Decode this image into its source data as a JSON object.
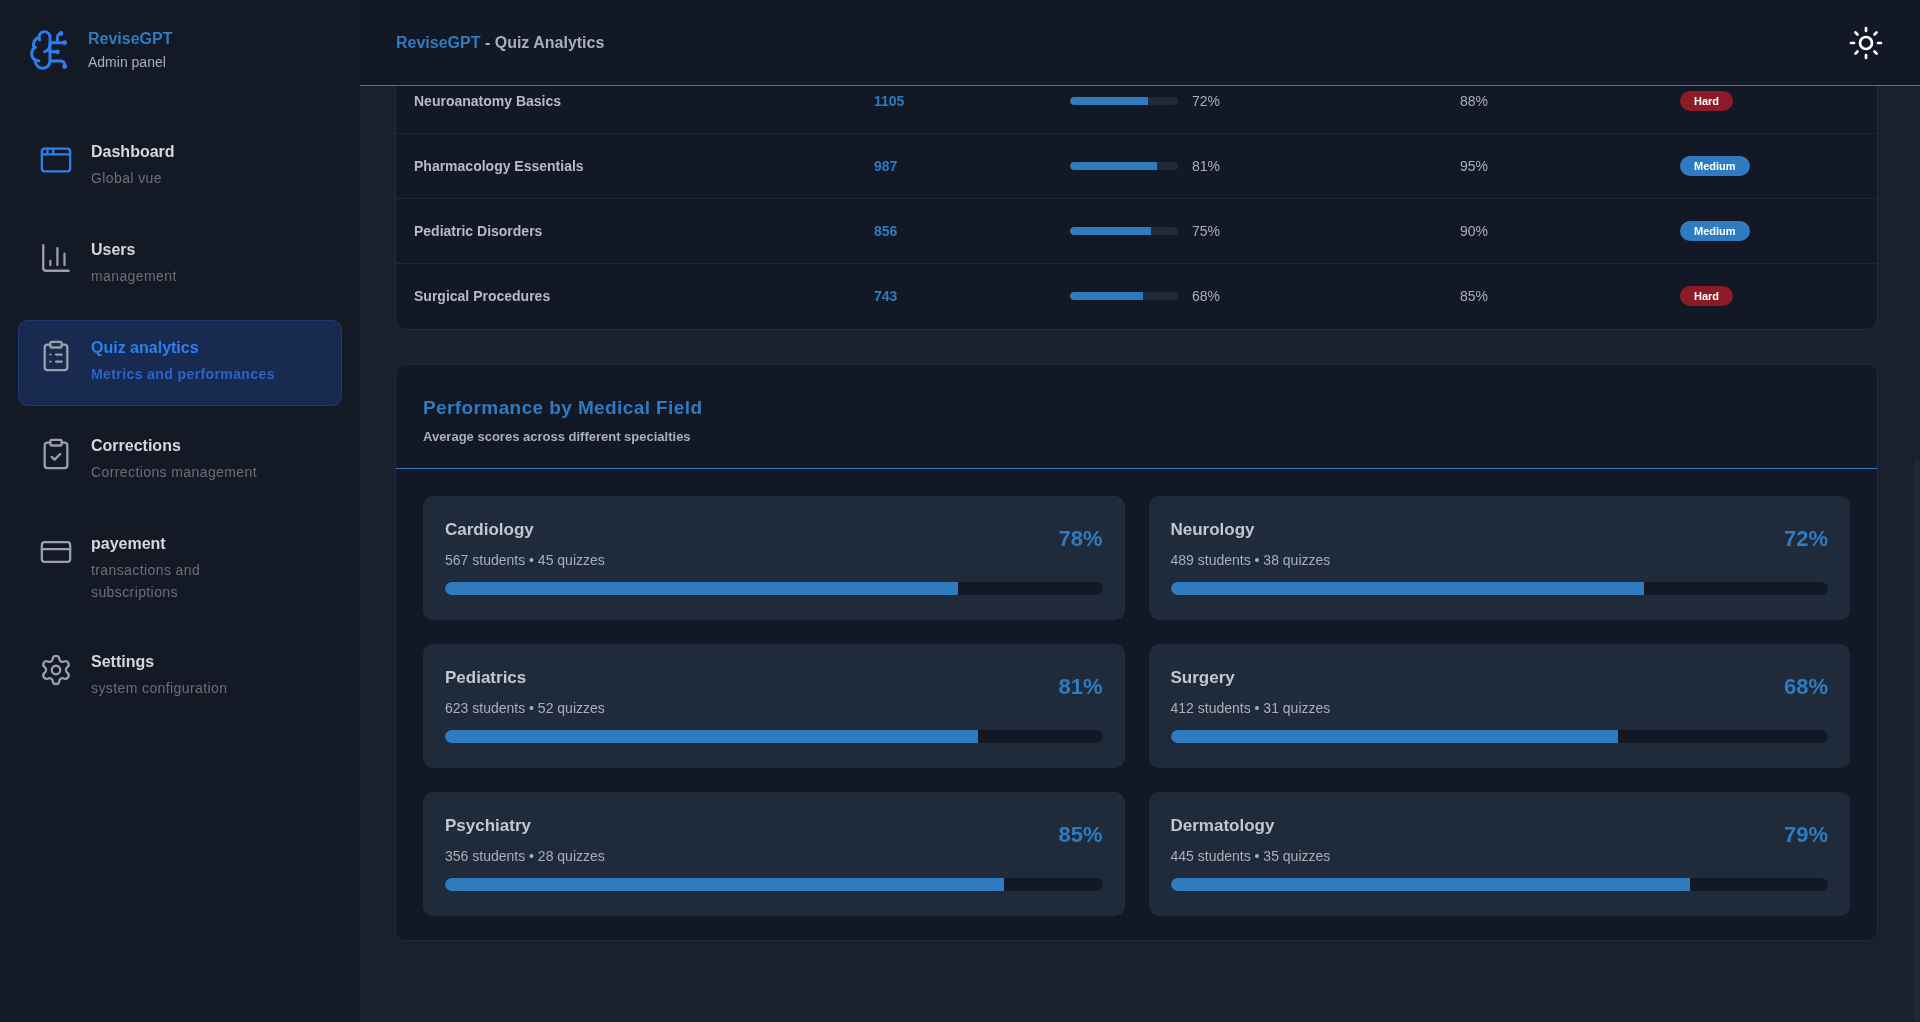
{
  "brand": {
    "name": "ReviseGPT",
    "subtitle": "Admin panel"
  },
  "nav": [
    {
      "kind": "dashboard",
      "title": "Dashboard",
      "subtitle": "Global vue",
      "selected": false
    },
    {
      "kind": "users",
      "title": "Users",
      "subtitle": "management",
      "selected": false
    },
    {
      "kind": "quiz",
      "title": "Quiz analytics",
      "subtitle": "Metrics and performances",
      "selected": true
    },
    {
      "kind": "corrections",
      "title": "Corrections",
      "subtitle": "Corrections management",
      "selected": false
    },
    {
      "kind": "payment",
      "title": "payement",
      "subtitle": "transactions and subscriptions",
      "selected": false
    },
    {
      "kind": "settings",
      "title": "Settings",
      "subtitle": "system configuration",
      "selected": false
    }
  ],
  "header": {
    "brand": "ReviseGPT",
    "title": " - Quiz Analytics"
  },
  "quiz_table": {
    "rows": [
      {
        "name": "Neuroanatomy Basics",
        "attempts": "1105",
        "level": 0.72,
        "average": "72%",
        "success": "88%",
        "difficulty": "Hard",
        "color": "#8b1c27"
      },
      {
        "name": "Pharmacology Essentials",
        "attempts": "987",
        "level": 0.81,
        "average": "81%",
        "success": "95%",
        "difficulty": "Medium",
        "color": "#2f7bbf"
      },
      {
        "name": "Pediatric Disorders",
        "attempts": "856",
        "level": 0.75,
        "average": "75%",
        "success": "90%",
        "difficulty": "Medium",
        "color": "#2f7bbf"
      },
      {
        "name": "Surgical Procedures",
        "attempts": "743",
        "level": 0.68,
        "average": "68%",
        "success": "85%",
        "difficulty": "Hard",
        "color": "#8b1c27"
      }
    ]
  },
  "performance": {
    "title": "Performance by Medical Field",
    "subtitle": "Average scores across different specialties",
    "fields": [
      {
        "name": "Cardiology",
        "stats": "567 students • 45 quizzes",
        "score": "78%",
        "level": 0.78
      },
      {
        "name": "Neurology",
        "stats": "489 students • 38 quizzes",
        "score": "72%",
        "level": 0.72
      },
      {
        "name": "Pediatrics",
        "stats": "623 students • 52 quizzes",
        "score": "81%",
        "level": 0.81
      },
      {
        "name": "Surgery",
        "stats": "412 students • 31 quizzes",
        "score": "68%",
        "level": 0.68
      },
      {
        "name": "Psychiatry",
        "stats": "356 students • 28 quizzes",
        "score": "85%",
        "level": 0.85
      },
      {
        "name": "Dermatology",
        "stats": "445 students • 35 quizzes",
        "score": "79%",
        "level": 0.79
      }
    ]
  }
}
